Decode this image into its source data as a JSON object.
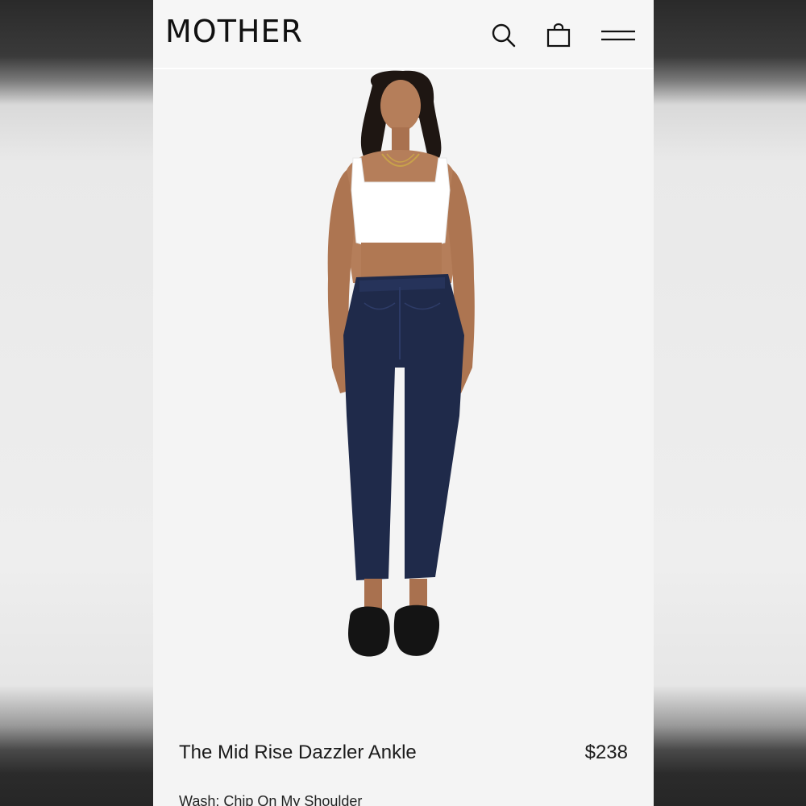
{
  "header": {
    "logo": "MOTHER",
    "search_icon": "search-icon",
    "bag_icon": "shopping-bag-icon",
    "menu_icon": "hamburger-menu-icon"
  },
  "product": {
    "name": "The Mid Rise Dazzler Ankle",
    "price": "$238",
    "wash_label": "Wash: Chip On My Shoulder"
  },
  "colors": {
    "background": "#f4f4f4",
    "text": "#111111",
    "denim": "#1f2a4a"
  }
}
